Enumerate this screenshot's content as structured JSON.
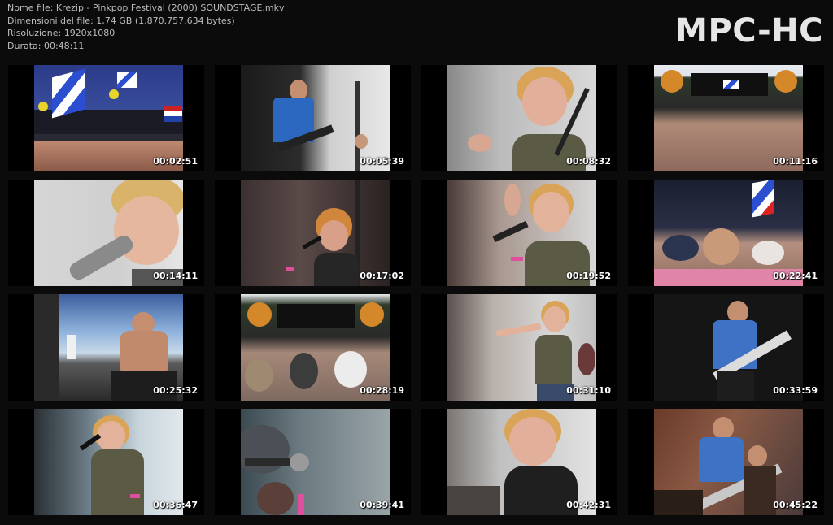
{
  "header": {
    "filename": "Nome file: Krezip - Pinkpop Festival (2000) SOUNDSTAGE.mkv",
    "filesize": "Dimensioni del file: 1,74 GB (1.870.757.634 bytes)",
    "resolution": "Risoluzione: 1920x1080",
    "duration": "Durata: 00:48:11"
  },
  "logo": "MPC-HC",
  "thumbnails": [
    {
      "time": "00:02:51",
      "scene": "festival-crowd-flags"
    },
    {
      "time": "00:05:39",
      "scene": "bassist-blue-shirt"
    },
    {
      "time": "00:08:32",
      "scene": "singer-closeup-mic"
    },
    {
      "time": "00:11:16",
      "scene": "stage-wide-crowd"
    },
    {
      "time": "00:14:11",
      "scene": "singer-face-closeup"
    },
    {
      "time": "00:17:02",
      "scene": "singer-dark-stage"
    },
    {
      "time": "00:19:52",
      "scene": "singer-singing-mic"
    },
    {
      "time": "00:22:41",
      "scene": "crowd-caps-flags"
    },
    {
      "time": "00:25:32",
      "scene": "stage-side-shirtless"
    },
    {
      "time": "00:28:19",
      "scene": "stage-wide-crowd-backs"
    },
    {
      "time": "00:31:10",
      "scene": "singer-pointing"
    },
    {
      "time": "00:33:59",
      "scene": "bassist-dark-stage"
    },
    {
      "time": "00:36:47",
      "scene": "singer-fullbody-mic"
    },
    {
      "time": "00:39:41",
      "scene": "microphone-blur"
    },
    {
      "time": "00:42:31",
      "scene": "singer-smiling"
    },
    {
      "time": "00:45:22",
      "scene": "bassist-guitarist"
    }
  ]
}
